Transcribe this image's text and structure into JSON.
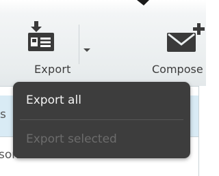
{
  "toolbar": {
    "export": {
      "label": "Export",
      "icon": "export-download-icon",
      "dropdown_icon": "chevron-down-icon"
    },
    "compose": {
      "label": "Compose",
      "icon": "compose-mail-icon"
    }
  },
  "background_list": {
    "partial_left_text": "s",
    "partial_row_text": "sonal Addresses"
  },
  "dropdown_menu": {
    "items": [
      {
        "label": "Export all",
        "enabled": true
      },
      {
        "label": "Export selected",
        "enabled": false
      }
    ]
  },
  "colors": {
    "menu_background": "#3d3d3d",
    "menu_text": "#f4f4f4",
    "menu_text_disabled": "#6c6c6c",
    "selection_highlight": "#d9ebf5",
    "icon_dark": "#3a3a3a"
  }
}
